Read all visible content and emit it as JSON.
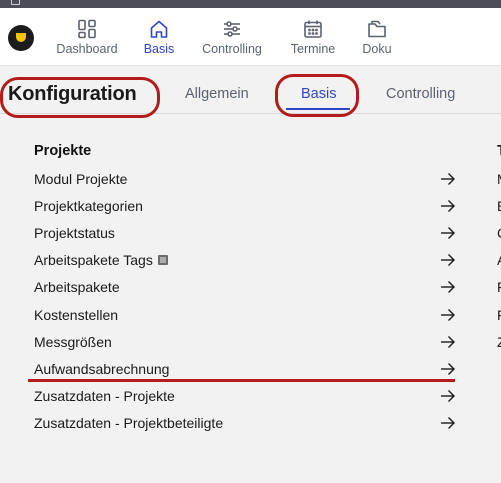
{
  "nav": {
    "items": [
      {
        "label": "Dashboard",
        "icon": "dashboard-icon"
      },
      {
        "label": "Basis",
        "icon": "home-icon"
      },
      {
        "label": "Controlling",
        "icon": "sliders-icon"
      },
      {
        "label": "Termine",
        "icon": "calendar-icon"
      },
      {
        "label": "Doku",
        "icon": "folder-icon"
      }
    ],
    "active": "Basis"
  },
  "header": {
    "title": "Konfiguration",
    "tabs": [
      {
        "label": "Allgemein"
      },
      {
        "label": "Basis"
      },
      {
        "label": "Controlling"
      }
    ],
    "active_tab": "Basis"
  },
  "section": {
    "title": "Projekte",
    "items": [
      {
        "label": "Modul Projekte"
      },
      {
        "label": "Projektkategorien"
      },
      {
        "label": "Projektstatus"
      },
      {
        "label": "Arbeitspakete Tags",
        "icon": "list-icon"
      },
      {
        "label": "Arbeitspakete"
      },
      {
        "label": "Kostenstellen"
      },
      {
        "label": "Messgrößen"
      },
      {
        "label": "Aufwandsabrechnung"
      },
      {
        "label": "Zusatzdaten - Projekte"
      },
      {
        "label": "Zusatzdaten - Projektbeteiligte"
      }
    ]
  },
  "second_column": {
    "head": "T",
    "letters": [
      "M",
      "E",
      "C",
      "A",
      "F",
      "F",
      "Z"
    ]
  },
  "colors": {
    "accent": "#3046c8",
    "annotation": "#b41c1c",
    "logo_yellow": "#f5c400"
  }
}
